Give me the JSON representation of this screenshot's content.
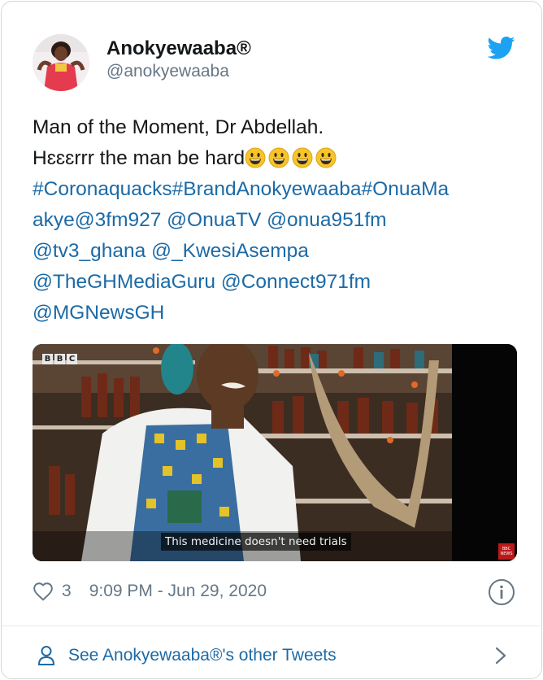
{
  "author": {
    "display_name": "Anokyewaaba®",
    "handle": "@anokyewaaba"
  },
  "tweet": {
    "lines": [
      [
        {
          "t": "Man of the Moment,  Dr Abdellah.",
          "link": false
        }
      ],
      [
        {
          "t": "Hɛɛɛrrr the man be hard",
          "link": false
        }
      ],
      [
        {
          "t": "#Coronaquacks",
          "link": true
        },
        {
          "t": "#BrandAnokyewaaba",
          "link": true
        },
        {
          "t": "#OnuaMa",
          "link": true
        }
      ],
      [
        {
          "t": "akye",
          "link": true
        },
        {
          "t": "@3fm927",
          "link": true
        },
        {
          "t": " ",
          "link": false
        },
        {
          "t": "@OnuaTV",
          "link": true
        },
        {
          "t": " ",
          "link": false
        },
        {
          "t": "@onua951fm",
          "link": true
        }
      ],
      [
        {
          "t": "@tv3_ghana",
          "link": true
        },
        {
          "t": " ",
          "link": false
        },
        {
          "t": "@_KwesiAsempa",
          "link": true
        }
      ],
      [
        {
          "t": "@TheGHMediaGuru",
          "link": true
        },
        {
          "t": " ",
          "link": false
        },
        {
          "t": "@Connect971fm",
          "link": true
        }
      ],
      [
        {
          "t": "@MGNewsGH",
          "link": true
        }
      ]
    ],
    "emoji_count": 4,
    "emoji_name": "grinning-face"
  },
  "media": {
    "broadcaster_logo": [
      "B",
      "B",
      "C"
    ],
    "subtitle": "This medicine doesn't need trials",
    "badge": "BBC NEWS"
  },
  "meta": {
    "like_count": "3",
    "timestamp": "9:09 PM - Jun 29, 2020"
  },
  "footer": {
    "link_label": "See Anokyewaaba®'s other Tweets"
  },
  "colors": {
    "link": "#1b6aa6",
    "twitter_blue": "#1da1f2",
    "muted": "#657786"
  },
  "icons": [
    "twitter-bird-icon",
    "heart-icon",
    "info-icon",
    "person-icon",
    "chevron-right-icon"
  ]
}
